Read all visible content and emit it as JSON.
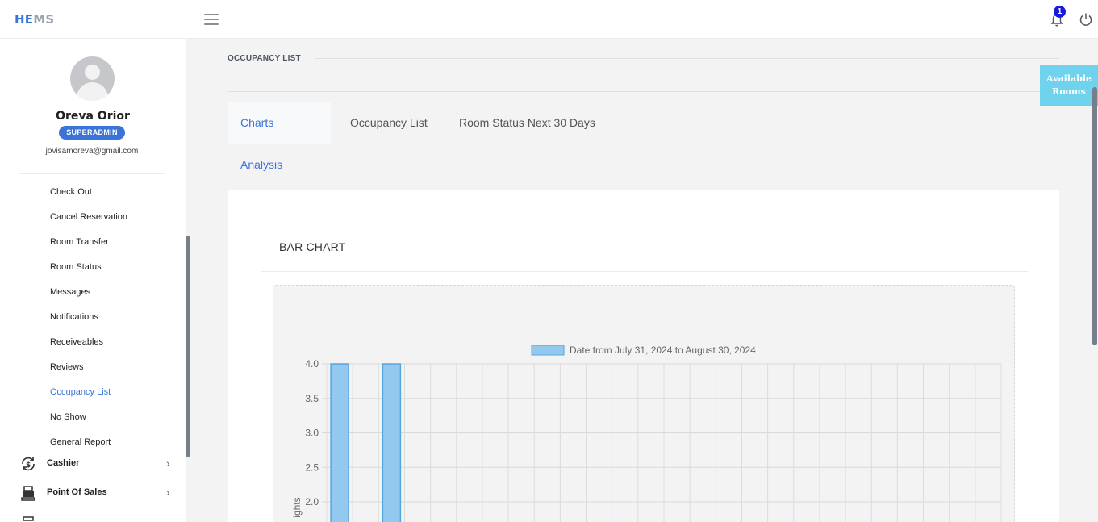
{
  "app": {
    "logo_part1": "HE",
    "logo_part2": "MS"
  },
  "topbar": {
    "notification_count": "1"
  },
  "user": {
    "name": "Oreva Orior",
    "role": "SUPERADMIN",
    "email": "jovisamoreva@gmail.com"
  },
  "sidebar": {
    "items": [
      {
        "label": "Check Out"
      },
      {
        "label": "Cancel Reservation"
      },
      {
        "label": "Room Transfer"
      },
      {
        "label": "Room Status"
      },
      {
        "label": "Messages"
      },
      {
        "label": "Notifications"
      },
      {
        "label": "Receiveables"
      },
      {
        "label": "Reviews"
      },
      {
        "label": "Occupancy List",
        "active": true
      },
      {
        "label": "No Show"
      },
      {
        "label": "General Report"
      }
    ],
    "groups": [
      {
        "label": "Cashier",
        "icon": "cashier-icon"
      },
      {
        "label": "Point Of Sales",
        "icon": "register-icon"
      }
    ]
  },
  "page": {
    "header": "OCCUPANCY LIST"
  },
  "tabs": [
    {
      "label": "Charts Analysis",
      "active": true
    },
    {
      "label": "Occupancy List"
    },
    {
      "label": "Room Status Next 30 Days"
    }
  ],
  "available_rooms_button": "Available Rooms",
  "card": {
    "title": "BAR CHART"
  },
  "colors": {
    "accent": "#3a74d9",
    "bar_fill": "#93c8ef",
    "bar_border": "#55a6e0",
    "available": "#6fd3ee"
  },
  "chart_data": {
    "type": "bar",
    "legend": "Date from July 31, 2024 to August 30, 2024",
    "ylabel_visible": "ights",
    "y_ticks": [
      "4.0",
      "3.5",
      "3.0",
      "2.5",
      "2.0"
    ],
    "ylim_visible": [
      2.0,
      4.0
    ],
    "num_categories": 26,
    "values": [
      4,
      0,
      4,
      0,
      0,
      0,
      0,
      0,
      0,
      0,
      0,
      0,
      0,
      0,
      0,
      0,
      0,
      0,
      0,
      0,
      0,
      0,
      0,
      0,
      0,
      0
    ]
  }
}
